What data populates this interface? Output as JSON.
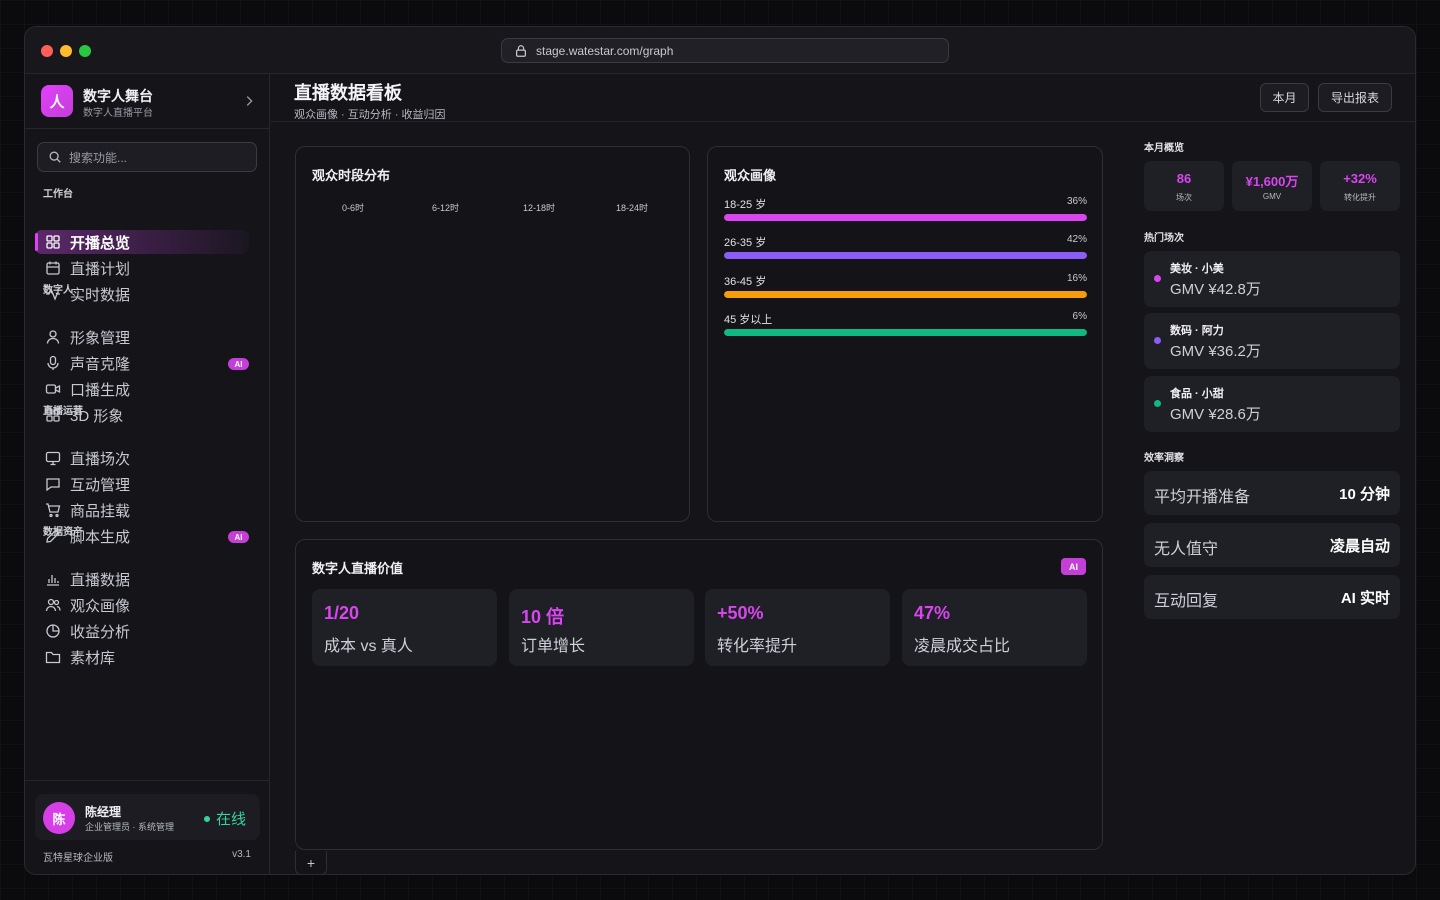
{
  "browser": {
    "url": "stage.watestar.com/graph"
  },
  "brand": {
    "logo": "人",
    "name": "数字人舞台",
    "subtitle": "数字人直播平台"
  },
  "search": {
    "placeholder": "搜索功能..."
  },
  "nav": {
    "sections": [
      {
        "label": "工作台",
        "items": [
          {
            "label": "开播总览",
            "icon": "grid-icon",
            "active": true
          },
          {
            "label": "直播计划",
            "icon": "calendar-icon"
          },
          {
            "label": "实时数据",
            "icon": "activity-icon"
          }
        ]
      },
      {
        "label": "数字人",
        "items": [
          {
            "label": "形象管理",
            "icon": "user-icon"
          },
          {
            "label": "声音克隆",
            "icon": "mic-icon",
            "badge": "AI"
          },
          {
            "label": "口播生成",
            "icon": "video-icon"
          },
          {
            "label": "3D 形象",
            "icon": "grid-icon"
          }
        ]
      },
      {
        "label": "直播运营",
        "items": [
          {
            "label": "直播场次",
            "icon": "monitor-icon"
          },
          {
            "label": "互动管理",
            "icon": "message-icon"
          },
          {
            "label": "商品挂载",
            "icon": "cart-icon"
          },
          {
            "label": "脚本生成",
            "icon": "pen-icon",
            "badge": "AI"
          }
        ]
      },
      {
        "label": "数据资产",
        "items": [
          {
            "label": "直播数据",
            "icon": "bar-chart-icon"
          },
          {
            "label": "观众画像",
            "icon": "users-icon"
          },
          {
            "label": "收益分析",
            "icon": "pie-chart-icon"
          },
          {
            "label": "素材库",
            "icon": "folder-icon"
          }
        ]
      }
    ]
  },
  "user": {
    "avatar": "陈",
    "name": "陈经理",
    "role": "企业管理员 · 系统管理",
    "status": "在线"
  },
  "footer": {
    "edition": "瓦特星球企业版",
    "version": "v3.1"
  },
  "header": {
    "title": "直播数据看板",
    "subtitle": "观众画像 · 互动分析 · 收益归因",
    "month_button": "本月",
    "export_button": "导出报表"
  },
  "time_panel": {
    "title": "观众时段分布",
    "labels": [
      "0-6时",
      "6-12时",
      "12-18时",
      "18-24时"
    ]
  },
  "audience": {
    "title": "观众画像",
    "rows": [
      {
        "label": "18-25 岁",
        "pct_text": "36%",
        "value": 36,
        "color": "#d946ef"
      },
      {
        "label": "26-35 岁",
        "pct_text": "42%",
        "value": 42,
        "color": "#8b5cf6"
      },
      {
        "label": "36-45 岁",
        "pct_text": "16%",
        "value": 16,
        "color": "#f59e0b"
      },
      {
        "label": "45 岁以上",
        "pct_text": "6%",
        "value": 6,
        "color": "#10b981"
      }
    ]
  },
  "value_panel": {
    "title": "数字人直播价值",
    "tag": "AI",
    "cards": [
      {
        "value": "1/20",
        "label": "成本 vs 真人"
      },
      {
        "value": "10 倍",
        "label": "订单增长"
      },
      {
        "value": "+50%",
        "label": "转化率提升"
      },
      {
        "value": "47%",
        "label": "凌晨成交占比"
      }
    ],
    "add_tab": "+"
  },
  "right": {
    "overview_title": "本月概览",
    "stats": [
      {
        "value": "86",
        "label": "场次"
      },
      {
        "value": "¥1,600万",
        "label": "GMV"
      },
      {
        "value": "+32%",
        "label": "转化提升"
      }
    ],
    "hot_title": "热门场次",
    "hot": [
      {
        "name": "美妆 · 小美",
        "gmv": "GMV ¥42.8万",
        "color": "#d946ef"
      },
      {
        "name": "数码 · 阿力",
        "gmv": "GMV ¥36.2万",
        "color": "#8b5cf6"
      },
      {
        "name": "食品 · 小甜",
        "gmv": "GMV ¥28.6万",
        "color": "#10b981"
      }
    ],
    "eff_title": "效率洞察",
    "efficiency": [
      {
        "label": "平均开播准备",
        "value": "10 分钟"
      },
      {
        "label": "无人值守",
        "value": "凌晨自动"
      },
      {
        "label": "互动回复",
        "value": "AI 实时"
      }
    ]
  }
}
